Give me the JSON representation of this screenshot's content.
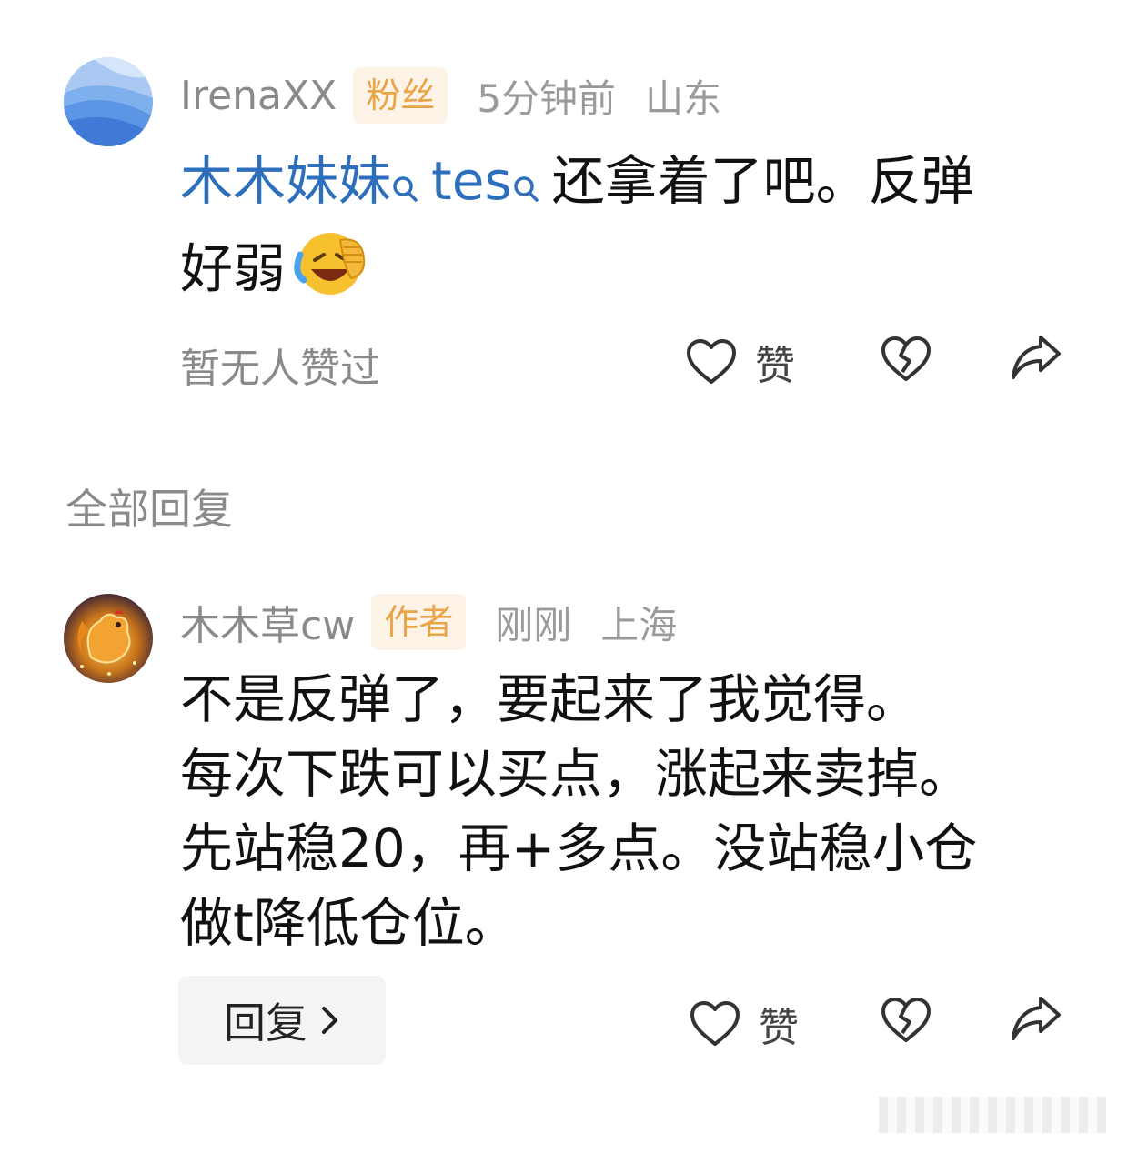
{
  "comment1": {
    "username": "IrenaXX",
    "badge": "粉丝",
    "time": "5分钟前",
    "location": "山东",
    "mention1": "木木妹妹",
    "mention2": "tes",
    "text_line1_rest": "还拿着了吧。反弹",
    "text_line2": "好弱",
    "emoji_icon": "laughing-tears-emoji-icon",
    "likes_status": "暂无人赞过",
    "like_label": "赞"
  },
  "section": {
    "title": "全部回复"
  },
  "comment2": {
    "username": "木木草cw",
    "badge": "作者",
    "time": "刚刚",
    "location": "上海",
    "text_lines": [
      "不是反弹了，要起来了我觉得。",
      "每次下跌可以买点，涨起来卖掉。",
      "先站稳20，再+多点。没站稳小仓",
      "做t降低仓位。"
    ],
    "reply_label": "回复",
    "like_label": "赞"
  },
  "colors": {
    "mention": "#2d6fbd",
    "badge_text": "#e8a447",
    "badge_bg": "#fdf3e6",
    "muted": "#8a8a8a"
  }
}
